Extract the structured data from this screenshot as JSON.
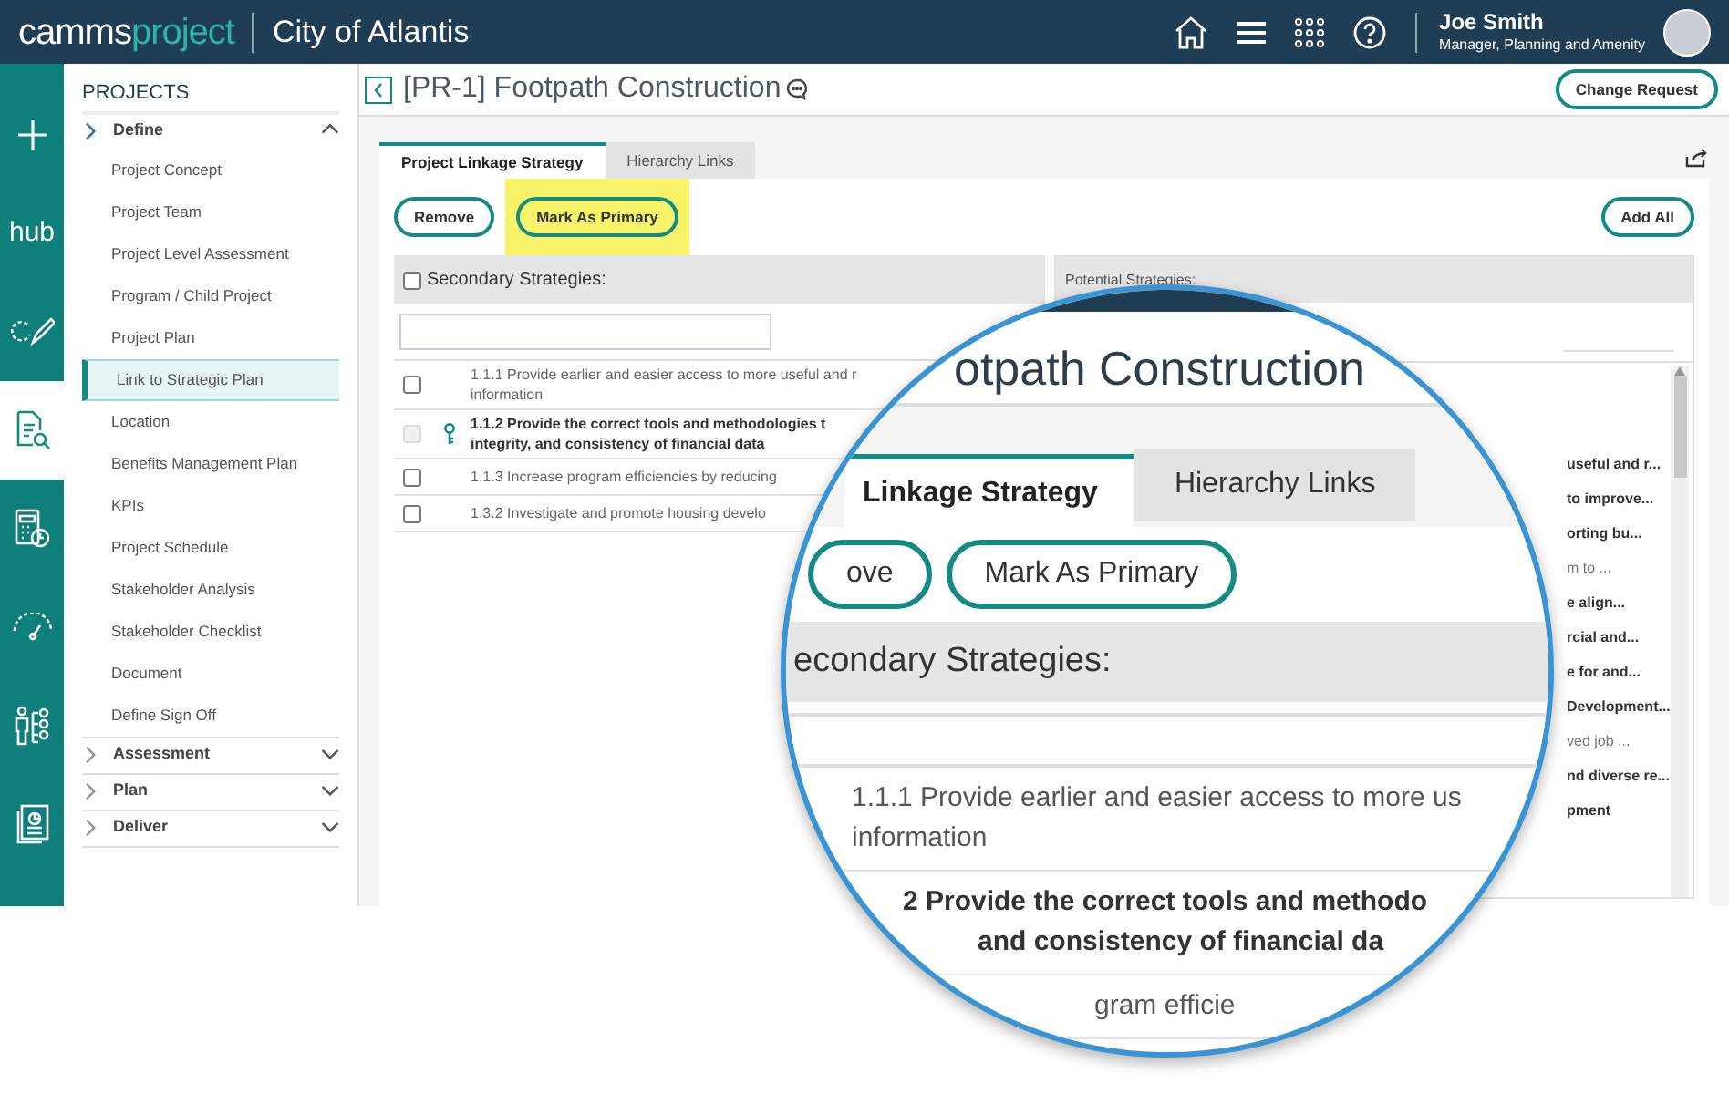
{
  "header": {
    "logo_primary": "camms",
    "logo_secondary": "project",
    "org": "City of Atlantis",
    "user": {
      "name": "Joe Smith",
      "role": "Manager, Planning and Amenity"
    }
  },
  "rail": [
    {
      "kind": "plus",
      "selected": false
    },
    {
      "kind": "text",
      "label": "hub",
      "selected": false
    },
    {
      "kind": "edit",
      "selected": false
    },
    {
      "kind": "search-doc",
      "selected": true
    },
    {
      "kind": "calc",
      "selected": false
    },
    {
      "kind": "gauge",
      "selected": false
    },
    {
      "kind": "tree",
      "selected": false
    },
    {
      "kind": "report",
      "selected": false
    }
  ],
  "sidebar": {
    "title": "PROJECTS",
    "groups": [
      {
        "label": "Define",
        "expanded": true,
        "items": [
          {
            "label": "Project Concept",
            "selected": false
          },
          {
            "label": "Project Team",
            "selected": false
          },
          {
            "label": "Project Level Assessment",
            "selected": false
          },
          {
            "label": "Program / Child Project",
            "selected": false
          },
          {
            "label": "Project Plan",
            "selected": false
          },
          {
            "label": "Link to Strategic Plan",
            "selected": true
          },
          {
            "label": "Location",
            "selected": false
          },
          {
            "label": "Benefits Management Plan",
            "selected": false
          },
          {
            "label": "KPIs",
            "selected": false
          },
          {
            "label": "Project Schedule",
            "selected": false
          },
          {
            "label": "Stakeholder Analysis",
            "selected": false
          },
          {
            "label": "Stakeholder Checklist",
            "selected": false
          },
          {
            "label": "Document",
            "selected": false
          },
          {
            "label": "Define Sign Off",
            "selected": false
          }
        ]
      },
      {
        "label": "Assessment",
        "expanded": false
      },
      {
        "label": "Plan",
        "expanded": false
      },
      {
        "label": "Deliver",
        "expanded": false
      }
    ]
  },
  "page": {
    "title": "[PR-1] Footpath Construction",
    "action": "Change Request"
  },
  "tabs": [
    {
      "label": "Project Linkage Strategy",
      "selected": true
    },
    {
      "label": "Hierarchy Links",
      "selected": false
    }
  ],
  "toolbar": {
    "buttons": [
      {
        "label": "Remove",
        "highlighted": false
      },
      {
        "label": "Mark As Primary",
        "highlighted": true
      }
    ],
    "add_all": "Add All"
  },
  "secondary": {
    "header": "Secondary Strategies:",
    "checked": false,
    "rows": [
      {
        "lines": [
          "1.1.1 Provide earlier and easier access to more useful and r",
          "information"
        ],
        "bold": false,
        "primary": false,
        "checked": false
      },
      {
        "lines": [
          "1.1.2 Provide the correct tools and methodologies t",
          "integrity, and consistency of financial data"
        ],
        "bold": true,
        "primary": true,
        "checked": false
      },
      {
        "lines": [
          "1.1.3 Increase program efficiencies by reducing"
        ],
        "bold": false,
        "primary": false,
        "checked": false
      },
      {
        "lines": [
          "1.3.2 Investigate and promote housing develo"
        ],
        "bold": false,
        "primary": false,
        "checked": false
      }
    ]
  },
  "potential": {
    "header": "Potential Strategies:",
    "rows": [
      {
        "text": "useful and r...",
        "bold": true
      },
      {
        "text": "to improve...",
        "bold": true
      },
      {
        "text": "orting bu...",
        "bold": true
      },
      {
        "text": "m to ...",
        "bold": false
      },
      {
        "text": "e align...",
        "bold": true
      },
      {
        "text": "rcial and...",
        "bold": true
      },
      {
        "text": "e for and...",
        "bold": true
      },
      {
        "text": "Development...",
        "bold": true
      },
      {
        "text": "ved job ...",
        "bold": false
      },
      {
        "text": "nd diverse re...",
        "bold": true
      },
      {
        "text": "pment",
        "bold": true
      }
    ]
  },
  "magnifier": {
    "title": "otpath Construction",
    "tabs": [
      {
        "label": "Linkage Strategy",
        "selected": true
      },
      {
        "label": "Hierarchy Links",
        "selected": false
      }
    ],
    "buttons": [
      "ove",
      "Mark As Primary"
    ],
    "header": "econdary Strategies:",
    "rows": [
      {
        "lines": [
          "1.1.1 Provide earlier and easier access to more us",
          "information"
        ],
        "bold": false
      },
      {
        "lines": [
          "2 Provide the correct tools and methodo",
          "and consistency of financial da"
        ],
        "bold": true
      },
      {
        "lines": [
          "gram efficie"
        ],
        "bold": false
      }
    ]
  }
}
